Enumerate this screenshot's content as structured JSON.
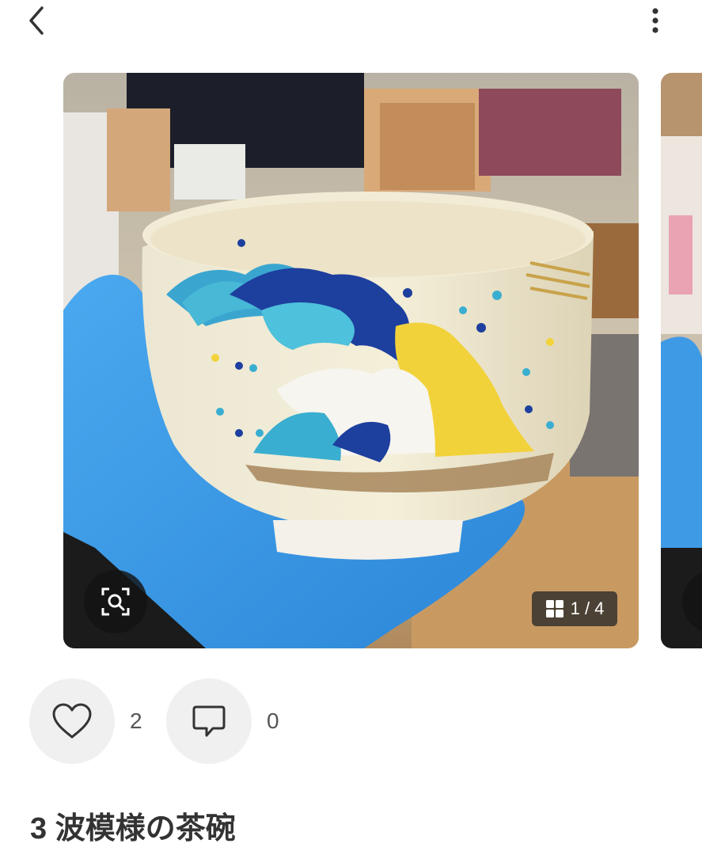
{
  "header": {
    "back_icon": "chevron-left-icon",
    "menu_icon": "more-vertical-icon"
  },
  "gallery": {
    "counter": "1 / 4",
    "counter_icon": "grid-icon",
    "lens_icon": "visual-search-icon",
    "current_index": 1,
    "total": 4
  },
  "actions": {
    "like_icon": "heart-icon",
    "like_count": "2",
    "comment_icon": "comment-icon",
    "comment_count": "0"
  },
  "item": {
    "title": "3 波模様の茶碗"
  },
  "colors": {
    "background": "#ffffff",
    "action_circle": "#f0f0f0",
    "text": "#333333",
    "overlay": "#1a1a1a"
  }
}
